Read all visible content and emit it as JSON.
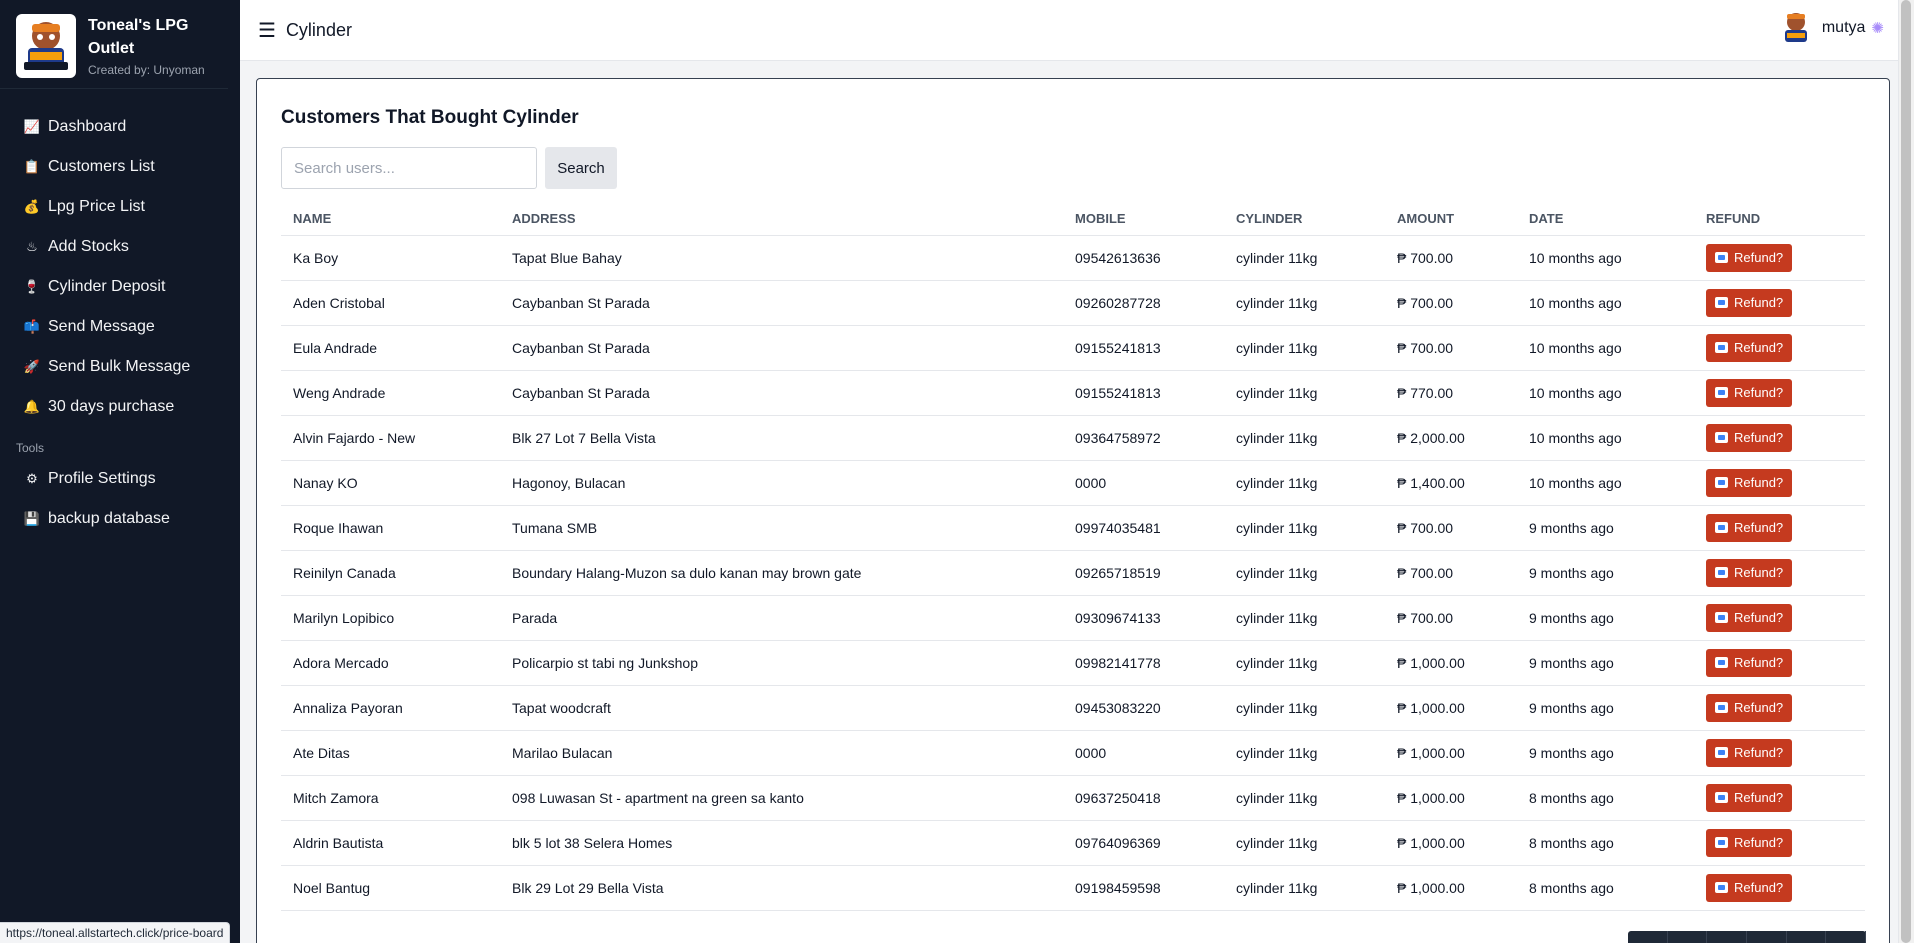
{
  "brand": {
    "title": "Toneal's LPG Outlet",
    "subtitle": "Created by: Unyoman"
  },
  "sidebar": {
    "items": [
      {
        "label": "Dashboard",
        "icon": "chart-icon"
      },
      {
        "label": "Customers List",
        "icon": "clipboard-icon"
      },
      {
        "label": "Lpg Price List",
        "icon": "money-bag-icon"
      },
      {
        "label": "Add Stocks",
        "icon": "hot-springs-icon"
      },
      {
        "label": "Cylinder Deposit",
        "icon": "wine-glass-icon"
      },
      {
        "label": "Send Message",
        "icon": "mailbox-icon"
      },
      {
        "label": "Send Bulk Message",
        "icon": "rocket-icon"
      },
      {
        "label": "30 days purchase",
        "icon": "bell-icon"
      }
    ],
    "tools_label": "Tools",
    "tools": [
      {
        "label": "Profile Settings",
        "icon": "gear-icon"
      },
      {
        "label": "backup database",
        "icon": "floppy-disk-icon"
      }
    ]
  },
  "header": {
    "title": "Cylinder",
    "username": "mutya"
  },
  "main": {
    "card_title": "Customers That Bought Cylinder",
    "search_placeholder": "Search users...",
    "search_button": "Search",
    "columns": [
      "NAME",
      "ADDRESS",
      "MOBILE",
      "CYLINDER",
      "AMOUNT",
      "DATE",
      "REFUND"
    ],
    "refund_label": "Refund?",
    "rows": [
      {
        "name": "Ka Boy",
        "address": "Tapat Blue Bahay",
        "mobile": "09542613636",
        "cylinder": "cylinder 11kg",
        "amount": "₱ 700.00",
        "date": "10 months ago"
      },
      {
        "name": "Aden Cristobal",
        "address": "Caybanban St Parada",
        "mobile": "09260287728",
        "cylinder": "cylinder 11kg",
        "amount": "₱ 700.00",
        "date": "10 months ago"
      },
      {
        "name": "Eula Andrade",
        "address": "Caybanban St Parada",
        "mobile": "09155241813",
        "cylinder": "cylinder 11kg",
        "amount": "₱ 700.00",
        "date": "10 months ago"
      },
      {
        "name": "Weng Andrade",
        "address": "Caybanban St Parada",
        "mobile": "09155241813",
        "cylinder": "cylinder 11kg",
        "amount": "₱ 770.00",
        "date": "10 months ago"
      },
      {
        "name": "Alvin Fajardo - New",
        "address": "Blk 27 Lot 7 Bella Vista",
        "mobile": "09364758972",
        "cylinder": "cylinder 11kg",
        "amount": "₱ 2,000.00",
        "date": "10 months ago"
      },
      {
        "name": "Nanay KO",
        "address": "Hagonoy, Bulacan",
        "mobile": "0000",
        "cylinder": "cylinder 11kg",
        "amount": "₱ 1,400.00",
        "date": "10 months ago"
      },
      {
        "name": "Roque Ihawan",
        "address": "Tumana SMB",
        "mobile": "09974035481",
        "cylinder": "cylinder 11kg",
        "amount": "₱ 700.00",
        "date": "9 months ago"
      },
      {
        "name": "Reinilyn Canada",
        "address": "Boundary Halang-Muzon sa dulo kanan may brown gate",
        "mobile": "09265718519",
        "cylinder": "cylinder 11kg",
        "amount": "₱ 700.00",
        "date": "9 months ago"
      },
      {
        "name": "Marilyn Lopibico",
        "address": "Parada",
        "mobile": "09309674133",
        "cylinder": "cylinder 11kg",
        "amount": "₱ 700.00",
        "date": "9 months ago"
      },
      {
        "name": "Adora Mercado",
        "address": "Policarpio st tabi ng Junkshop",
        "mobile": "09982141778",
        "cylinder": "cylinder 11kg",
        "amount": "₱ 1,000.00",
        "date": "9 months ago"
      },
      {
        "name": "Annaliza Payoran",
        "address": "Tapat woodcraft",
        "mobile": "09453083220",
        "cylinder": "cylinder 11kg",
        "amount": "₱ 1,000.00",
        "date": "9 months ago"
      },
      {
        "name": "Ate Ditas",
        "address": "Marilao Bulacan",
        "mobile": "0000",
        "cylinder": "cylinder 11kg",
        "amount": "₱ 1,000.00",
        "date": "9 months ago"
      },
      {
        "name": "Mitch Zamora",
        "address": "098 Luwasan St - apartment na green sa kanto",
        "mobile": "09637250418",
        "cylinder": "cylinder 11kg",
        "amount": "₱ 1,000.00",
        "date": "8 months ago"
      },
      {
        "name": "Aldrin Bautista",
        "address": "blk 5 lot 38 Selera Homes",
        "mobile": "09764096369",
        "cylinder": "cylinder 11kg",
        "amount": "₱ 1,000.00",
        "date": "8 months ago"
      },
      {
        "name": "Noel Bantug",
        "address": "Blk 29 Lot 29 Bella Vista",
        "mobile": "09198459598",
        "cylinder": "cylinder 11kg",
        "amount": "₱ 1,000.00",
        "date": "8 months ago"
      }
    ]
  },
  "statusbar": {
    "url": "https://toneal.allstartech.click/price-board"
  },
  "colors": {
    "sidebar_bg": "#111827",
    "refund_button": "#c53a1f",
    "accent": "#3b82f6"
  }
}
